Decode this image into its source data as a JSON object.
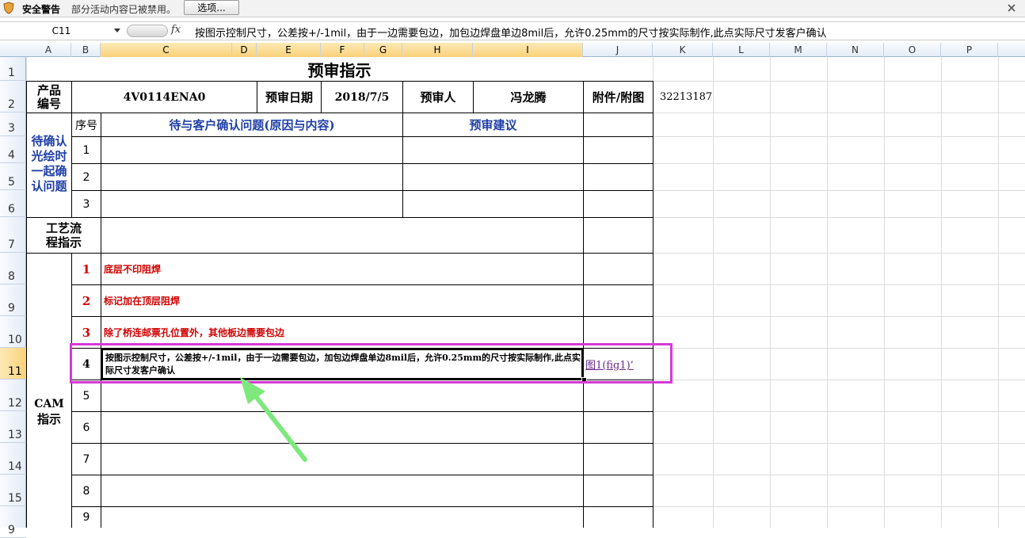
{
  "security_bar": {
    "title": "安全警告",
    "message": "部分活动内容已被禁用。",
    "options_button": "选项..."
  },
  "formula_bar": {
    "name_box": "C11",
    "fx": "fx",
    "content": "按图示控制尺寸，公差按+/-1mil，由于一边需要包边，加包边焊盘单边8mil后，允许0.25mm的尺寸按实际制作,此点实际尺寸发客户确认"
  },
  "columns": [
    "A",
    "B",
    "C",
    "D",
    "E",
    "F",
    "G",
    "H",
    "I",
    "J",
    "K",
    "L",
    "M",
    "N",
    "O",
    "P"
  ],
  "rows": [
    "1",
    "2",
    "3",
    "4",
    "5",
    "6",
    "7",
    "8",
    "9",
    "10",
    "11",
    "12",
    "13",
    "14",
    "15",
    "9"
  ],
  "selected_cell": {
    "column": "C",
    "row": "11"
  },
  "sheet": {
    "title": "预审指示",
    "product_no_label": "产品编号",
    "product_no": "4V0114ENA0",
    "review_date_label": "预审日期",
    "review_date": "2018/7/5",
    "reviewer_label": "预审人",
    "reviewer": "冯龙腾",
    "attachment_label": "附件/附图",
    "k2_value": "32213187",
    "seq_label": "序号",
    "issues_header": "待与客户确认问题(原因与内容)",
    "suggestion_header": "预审建议",
    "pending_label": "待确认光绘时一起确认问题",
    "pending_rows": [
      "1",
      "2",
      "3"
    ],
    "process_label": "工艺流程指示",
    "cam_label_1": "CAM",
    "cam_label_2": "指示",
    "cam_items": [
      {
        "num": "1",
        "text": "底层不印阻焊"
      },
      {
        "num": "2",
        "text": "标记加在顶层阻焊"
      },
      {
        "num": "3",
        "text": "除了桥连邮票孔位置外，其他板边需要包边"
      },
      {
        "num": "4",
        "text": "按图示控制尺寸，公差按+/-1mil，由于一边需要包边，加包边焊盘单边8mil后，允许0.25mm的尺寸按实际制作,此点实际尺寸发客户确认",
        "link": "图1(fig1)’"
      },
      {
        "num": "5",
        "text": ""
      },
      {
        "num": "6",
        "text": ""
      },
      {
        "num": "7",
        "text": ""
      },
      {
        "num": "8",
        "text": ""
      },
      {
        "num": "9",
        "text": ""
      }
    ]
  },
  "annotation": {
    "highlight_color": "#d53ad5",
    "arrow_color": "#7ee87e"
  }
}
